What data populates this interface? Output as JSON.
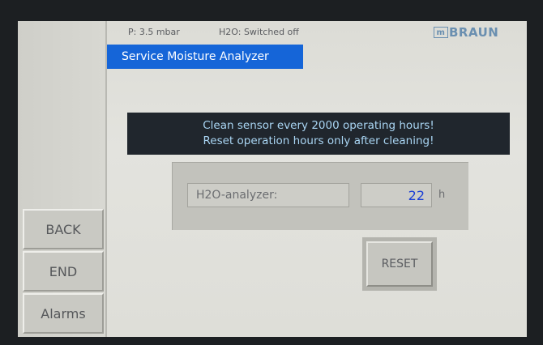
{
  "status": {
    "pressure": "P:   3.5 mbar",
    "h2o_status": "H2O: Switched off"
  },
  "brand": {
    "logo_mark": "m",
    "logo_text": "BRAUN"
  },
  "page_title": "Service Moisture Analyzer",
  "notice": {
    "line1": "Clean sensor every 2000 operating hours!",
    "line2": "Reset operation hours only after cleaning!"
  },
  "analyzer": {
    "label": "H2O-analyzer:",
    "value": "22",
    "unit": "h"
  },
  "buttons": {
    "reset": "RESET",
    "back": "BACK",
    "end": "END",
    "alarms": "Alarms"
  },
  "colors": {
    "title_bar": "#1565d8",
    "notice_bg": "#20262d",
    "notice_text": "#a9d5f3",
    "value_text": "#1a3fd6"
  }
}
